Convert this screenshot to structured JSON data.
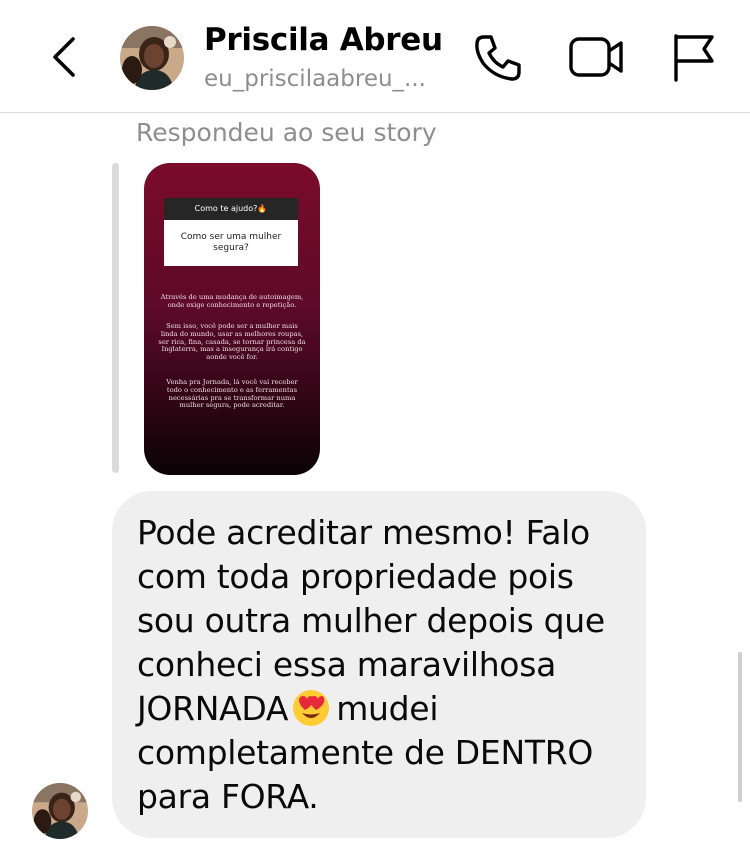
{
  "header": {
    "contact_name": "Priscila Abreu",
    "contact_handle": "eu_priscilaabreu_...",
    "icons": [
      "back-chevron-icon",
      "phone-icon",
      "video-camera-icon",
      "flag-icon"
    ]
  },
  "story_reply": {
    "caption": "Respondeu ao seu story",
    "question_header": "Como te ajudo?🔥",
    "question_answer": "Como ser uma mulher segura?",
    "body_paragraphs": [
      "Através de uma mudança de autoimagem, onde exige conhecimento e repetição.",
      "Sem isso, você pode ser a mulher mais linda do mundo, usar as melhores roupas, ser rica, fina, casada, se tornar princesa da Inglaterra, mas a insegurança irá contigo aonde você for.",
      "Venha pra Jornada, lá você vai receber todo o conhecimento e as ferramentas necessárias pra se transformar numa mulher segura, pode acreditar."
    ],
    "gradient_colors": [
      "#7a0b2b",
      "#0b0306"
    ]
  },
  "message": {
    "text_before_emoji": "Pode acreditar mesmo! Falo com toda propriedade pois sou outra mulher depois que conheci essa maravilhosa JORNADA",
    "emoji": "heart-eyes-emoji",
    "text_after_emoji": "mudei completamente de DENTRO para FORA.",
    "bubble_color": "#efefef"
  }
}
